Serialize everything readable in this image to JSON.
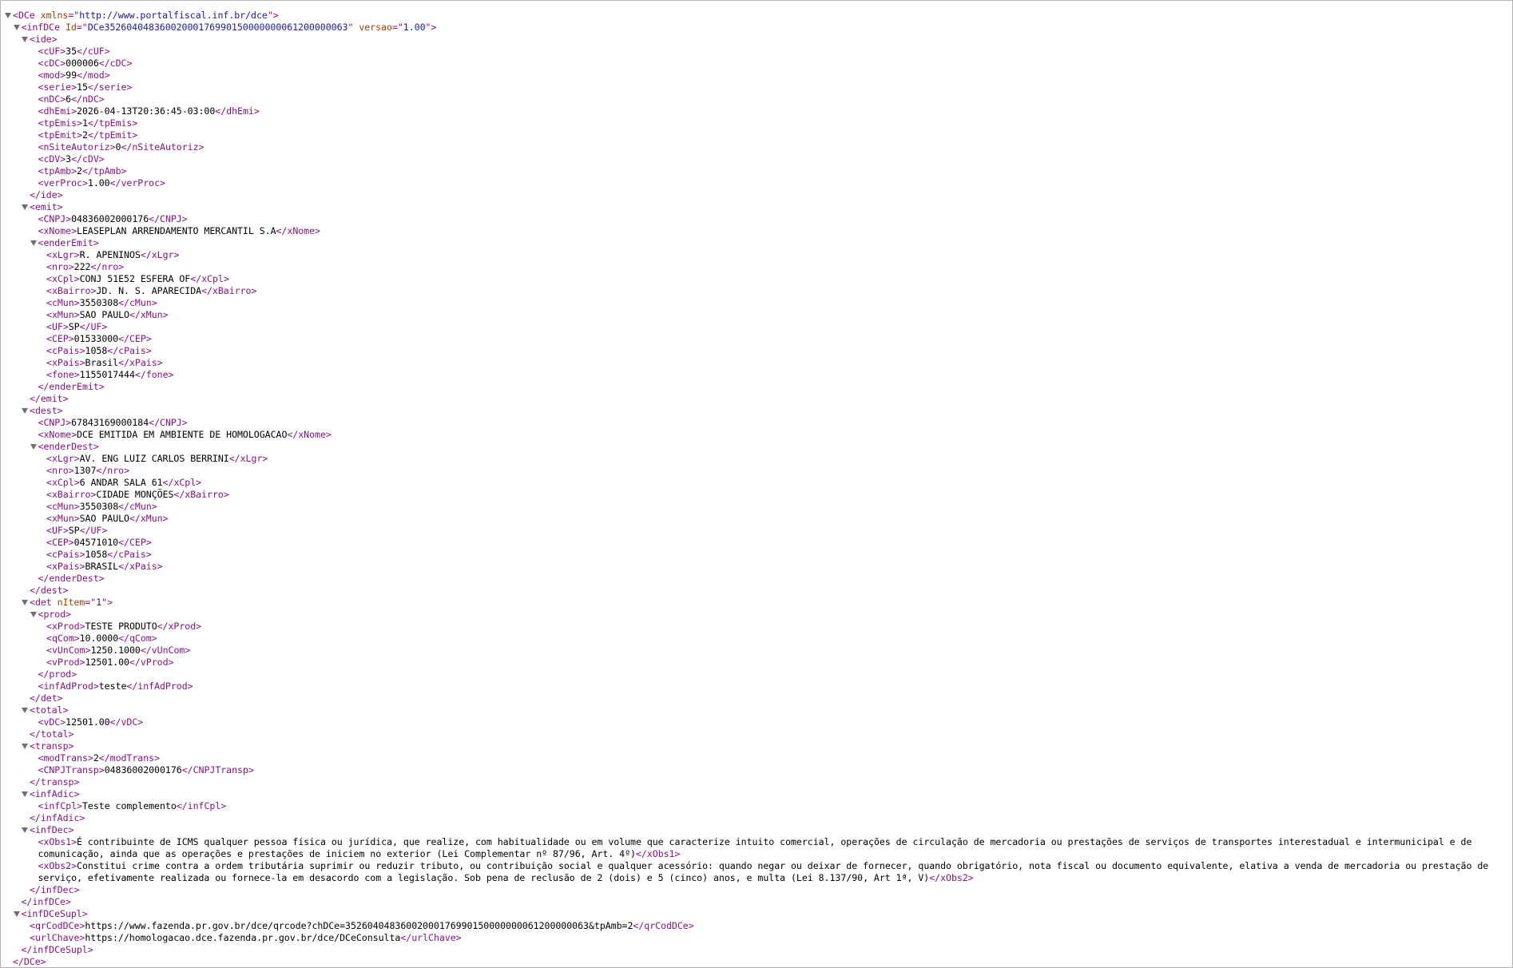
{
  "document": {
    "lines": [
      {
        "d": 0,
        "t": "open",
        "n": "DCe",
        "a": [
          [
            "xmlns",
            "http://www.portalfiscal.inf.br/dce"
          ]
        ]
      },
      {
        "d": 1,
        "t": "open",
        "n": "infDCe",
        "a": [
          [
            "Id",
            "DCe35260404836002000176990150000000061200000063"
          ],
          [
            "versao",
            "1.00"
          ]
        ]
      },
      {
        "d": 2,
        "t": "open",
        "n": "ide"
      },
      {
        "d": 3,
        "t": "leaf",
        "n": "cUF",
        "v": "35"
      },
      {
        "d": 3,
        "t": "leaf",
        "n": "cDC",
        "v": "000006"
      },
      {
        "d": 3,
        "t": "leaf",
        "n": "mod",
        "v": "99"
      },
      {
        "d": 3,
        "t": "leaf",
        "n": "serie",
        "v": "15"
      },
      {
        "d": 3,
        "t": "leaf",
        "n": "nDC",
        "v": "6"
      },
      {
        "d": 3,
        "t": "leaf",
        "n": "dhEmi",
        "v": "2026-04-13T20:36:45-03:00"
      },
      {
        "d": 3,
        "t": "leaf",
        "n": "tpEmis",
        "v": "1"
      },
      {
        "d": 3,
        "t": "leaf",
        "n": "tpEmit",
        "v": "2"
      },
      {
        "d": 3,
        "t": "leaf",
        "n": "nSiteAutoriz",
        "v": "0"
      },
      {
        "d": 3,
        "t": "leaf",
        "n": "cDV",
        "v": "3"
      },
      {
        "d": 3,
        "t": "leaf",
        "n": "tpAmb",
        "v": "2"
      },
      {
        "d": 3,
        "t": "leaf",
        "n": "verProc",
        "v": "1.00"
      },
      {
        "d": 2,
        "t": "close",
        "n": "ide"
      },
      {
        "d": 2,
        "t": "open",
        "n": "emit"
      },
      {
        "d": 3,
        "t": "leaf",
        "n": "CNPJ",
        "v": "04836002000176"
      },
      {
        "d": 3,
        "t": "leaf",
        "n": "xNome",
        "v": "LEASEPLAN ARRENDAMENTO MERCANTIL S.A"
      },
      {
        "d": 3,
        "t": "open",
        "n": "enderEmit"
      },
      {
        "d": 4,
        "t": "leaf",
        "n": "xLgr",
        "v": "R. APENINOS"
      },
      {
        "d": 4,
        "t": "leaf",
        "n": "nro",
        "v": "222"
      },
      {
        "d": 4,
        "t": "leaf",
        "n": "xCpl",
        "v": "CONJ 51E52 ESFERA OF"
      },
      {
        "d": 4,
        "t": "leaf",
        "n": "xBairro",
        "v": "JD. N. S. APARECIDA"
      },
      {
        "d": 4,
        "t": "leaf",
        "n": "cMun",
        "v": "3550308"
      },
      {
        "d": 4,
        "t": "leaf",
        "n": "xMun",
        "v": "SAO PAULO"
      },
      {
        "d": 4,
        "t": "leaf",
        "n": "UF",
        "v": "SP"
      },
      {
        "d": 4,
        "t": "leaf",
        "n": "CEP",
        "v": "01533000"
      },
      {
        "d": 4,
        "t": "leaf",
        "n": "cPais",
        "v": "1058"
      },
      {
        "d": 4,
        "t": "leaf",
        "n": "xPais",
        "v": "Brasil"
      },
      {
        "d": 4,
        "t": "leaf",
        "n": "fone",
        "v": "1155017444"
      },
      {
        "d": 3,
        "t": "close",
        "n": "enderEmit"
      },
      {
        "d": 2,
        "t": "close",
        "n": "emit"
      },
      {
        "d": 2,
        "t": "open",
        "n": "dest"
      },
      {
        "d": 3,
        "t": "leaf",
        "n": "CNPJ",
        "v": "67843169000184"
      },
      {
        "d": 3,
        "t": "leaf",
        "n": "xNome",
        "v": "DCE EMITIDA EM AMBIENTE DE HOMOLOGACAO"
      },
      {
        "d": 3,
        "t": "open",
        "n": "enderDest"
      },
      {
        "d": 4,
        "t": "leaf",
        "n": "xLgr",
        "v": "AV. ENG LUIZ CARLOS BERRINI"
      },
      {
        "d": 4,
        "t": "leaf",
        "n": "nro",
        "v": "1307"
      },
      {
        "d": 4,
        "t": "leaf",
        "n": "xCpl",
        "v": "6 ANDAR SALA 61"
      },
      {
        "d": 4,
        "t": "leaf",
        "n": "xBairro",
        "v": "CIDADE MONÇÕES"
      },
      {
        "d": 4,
        "t": "leaf",
        "n": "cMun",
        "v": "3550308"
      },
      {
        "d": 4,
        "t": "leaf",
        "n": "xMun",
        "v": "SAO PAULO"
      },
      {
        "d": 4,
        "t": "leaf",
        "n": "UF",
        "v": "SP"
      },
      {
        "d": 4,
        "t": "leaf",
        "n": "CEP",
        "v": "04571010"
      },
      {
        "d": 4,
        "t": "leaf",
        "n": "cPais",
        "v": "1058"
      },
      {
        "d": 4,
        "t": "leaf",
        "n": "xPais",
        "v": "BRASIL"
      },
      {
        "d": 3,
        "t": "close",
        "n": "enderDest"
      },
      {
        "d": 2,
        "t": "close",
        "n": "dest"
      },
      {
        "d": 2,
        "t": "open",
        "n": "det",
        "a": [
          [
            "nItem",
            "1"
          ]
        ]
      },
      {
        "d": 3,
        "t": "open",
        "n": "prod"
      },
      {
        "d": 4,
        "t": "leaf",
        "n": "xProd",
        "v": "TESTE PRODUTO"
      },
      {
        "d": 4,
        "t": "leaf",
        "n": "qCom",
        "v": "10.0000"
      },
      {
        "d": 4,
        "t": "leaf",
        "n": "vUnCom",
        "v": "1250.1000"
      },
      {
        "d": 4,
        "t": "leaf",
        "n": "vProd",
        "v": "12501.00"
      },
      {
        "d": 3,
        "t": "close",
        "n": "prod"
      },
      {
        "d": 3,
        "t": "leaf",
        "n": "infAdProd",
        "v": "teste"
      },
      {
        "d": 2,
        "t": "close",
        "n": "det"
      },
      {
        "d": 2,
        "t": "open",
        "n": "total"
      },
      {
        "d": 3,
        "t": "leaf",
        "n": "vDC",
        "v": "12501.00"
      },
      {
        "d": 2,
        "t": "close",
        "n": "total"
      },
      {
        "d": 2,
        "t": "open",
        "n": "transp"
      },
      {
        "d": 3,
        "t": "leaf",
        "n": "modTrans",
        "v": "2"
      },
      {
        "d": 3,
        "t": "leaf",
        "n": "CNPJTransp",
        "v": "04836002000176"
      },
      {
        "d": 2,
        "t": "close",
        "n": "transp"
      },
      {
        "d": 2,
        "t": "open",
        "n": "infAdic"
      },
      {
        "d": 3,
        "t": "leaf",
        "n": "infCpl",
        "v": "Teste complemento"
      },
      {
        "d": 2,
        "t": "close",
        "n": "infAdic"
      },
      {
        "d": 2,
        "t": "open",
        "n": "infDec"
      },
      {
        "d": 3,
        "t": "leaf",
        "n": "xObs1",
        "v": "É contribuinte de ICMS qualquer pessoa física ou jurídica, que realize, com habitualidade ou em volume que caracterize intuito comercial, operações de circulação de mercadoria ou prestações de serviços de transportes interestadual e intermunicipal e de comunicação, ainda que as operações e prestações de iniciem no exterior (Lei Complementar nº 87/96, Art. 4º)",
        "wrap": true
      },
      {
        "d": 3,
        "t": "leaf",
        "n": "xObs2",
        "v": "Constitui crime contra a ordem tributária suprimir ou reduzir tributo, ou contribuição social e qualquer acessório: quando negar ou deixar de fornecer, quando obrigatório, nota fiscal ou documento equivalente, elativa a venda de mercadoria ou prestação de serviço, efetivamente realizada ou fornece-la em desacordo com a legislação. Sob pena de reclusão de 2 (dois) e 5 (cinco) anos, e multa (Lei 8.137/90, Art 1ª, V)",
        "wrap": true
      },
      {
        "d": 2,
        "t": "close",
        "n": "infDec"
      },
      {
        "d": 1,
        "t": "close",
        "n": "infDCe"
      },
      {
        "d": 1,
        "t": "open",
        "n": "infDCeSupl"
      },
      {
        "d": 2,
        "t": "leaf",
        "n": "qrCodDCe",
        "v": "https://www.fazenda.pr.gov.br/dce/qrcode?chDCe=35260404836002000176990150000000061200000063&tpAmb=2"
      },
      {
        "d": 2,
        "t": "leaf",
        "n": "urlChave",
        "v": "https://homologacao.dce.fazenda.pr.gov.br/dce/DCeConsulta"
      },
      {
        "d": 1,
        "t": "close",
        "n": "infDCeSupl"
      },
      {
        "d": 0,
        "t": "close",
        "n": "DCe"
      }
    ]
  }
}
